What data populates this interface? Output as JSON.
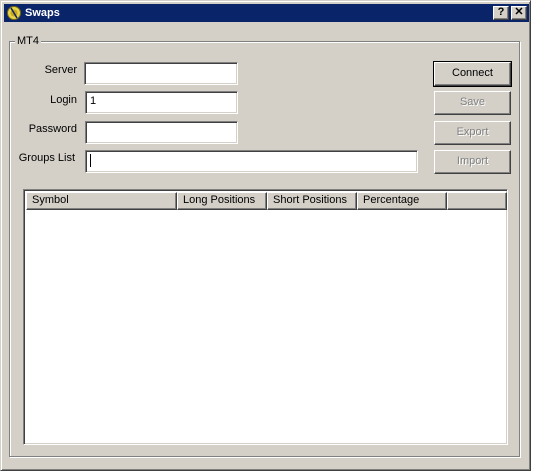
{
  "window": {
    "title": "Swaps",
    "help_label": "?",
    "close_label": "✕"
  },
  "group": {
    "label": "MT4"
  },
  "form": {
    "server": {
      "label": "Server",
      "value": ""
    },
    "login": {
      "label": "Login",
      "value": "1"
    },
    "password": {
      "label": "Password",
      "value": ""
    },
    "groups_list": {
      "label": "Groups List",
      "value": ""
    }
  },
  "buttons": {
    "connect": "Connect",
    "save": "Save",
    "export": "Export",
    "import": "Import"
  },
  "table": {
    "columns": [
      "Symbol",
      "Long Positions",
      "Short Positions",
      "Percentage",
      ""
    ]
  },
  "colors": {
    "titlebar": "#0a246a",
    "face": "#d4d0c8",
    "disabled_text": "#808080"
  }
}
